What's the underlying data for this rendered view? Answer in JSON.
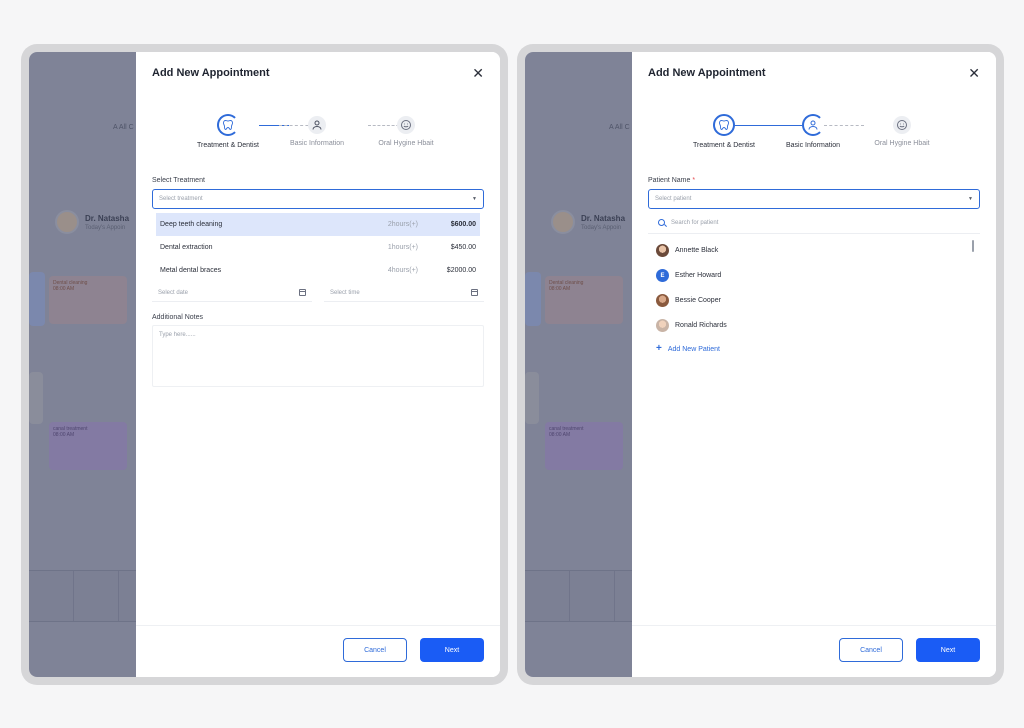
{
  "modal": {
    "title": "Add New Appointment",
    "close_icon": "close-icon",
    "cancel_label": "Cancel",
    "next_label": "Next"
  },
  "steps": [
    {
      "label": "Treatment & Dentist",
      "icon": "tooth-icon"
    },
    {
      "label": "Basic Information",
      "icon": "user-icon"
    },
    {
      "label": "Oral Hygine Hbait",
      "icon": "smile-icon"
    }
  ],
  "background": {
    "search_fragment": "A  All C",
    "doctor_name": "Dr. Natasha",
    "doctor_sub": "Today's Appoin",
    "card_orange_title": "Dental cleaning",
    "card_orange_time": "08:00 AM",
    "card_purple_title": "canal treatment",
    "card_purple_time": "08:00 AM"
  },
  "left_panel": {
    "select_label": "Select Treatment",
    "select_placeholder": "Select treatment",
    "treatments": [
      {
        "name": "Deep teeth cleaning",
        "duration": "2hours(+)",
        "price": "$600.00",
        "selected": true
      },
      {
        "name": "Dental extraction",
        "duration": "1hours(+)",
        "price": "$450.00",
        "selected": false
      },
      {
        "name": "Metal dental braces",
        "duration": "4hours(+)",
        "price": "$2000.00",
        "selected": false
      }
    ],
    "date_placeholder": "Select date",
    "time_placeholder": "Select time",
    "notes_label": "Additional Notes",
    "notes_placeholder": "Type here......"
  },
  "right_panel": {
    "patient_label": "Patient Name",
    "required_mark": "*",
    "select_placeholder": "Select patient",
    "search_placeholder": "Search for patient",
    "patients": [
      {
        "name": "Annette Black",
        "initial": ""
      },
      {
        "name": "Esther Howard",
        "initial": "E"
      },
      {
        "name": "Bessie Cooper",
        "initial": ""
      },
      {
        "name": "Ronald Richards",
        "initial": ""
      }
    ],
    "add_patient_label": "Add New Patient"
  },
  "colors": {
    "accent": "#1a5cf5",
    "step_active": "#2f6bd9",
    "selected_row": "#dde6fb",
    "required": "#e5484d"
  }
}
